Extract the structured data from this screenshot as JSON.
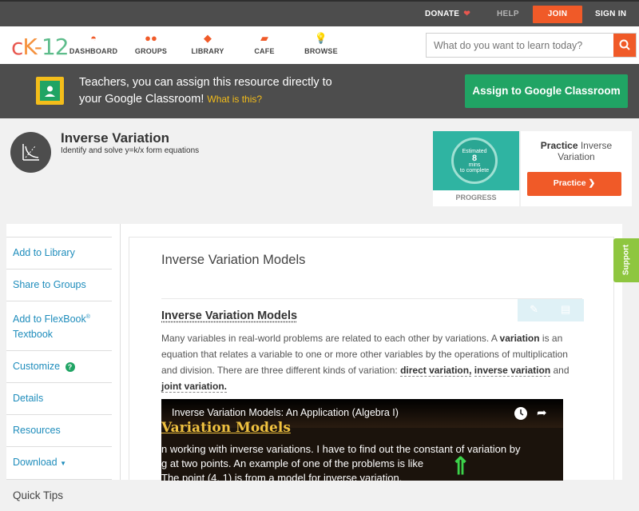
{
  "topbar": {
    "donate": "DONATE",
    "help": "HELP",
    "join": "JOIN",
    "signin": "SIGN IN"
  },
  "logo": {
    "text_c": "c",
    "text_k": "K-",
    "text_12": "12"
  },
  "nav": [
    {
      "label": "DASHBOARD",
      "icon": "dashboard-icon"
    },
    {
      "label": "GROUPS",
      "icon": "groups-icon"
    },
    {
      "label": "LIBRARY",
      "icon": "library-icon"
    },
    {
      "label": "CAFE",
      "icon": "cafe-icon"
    },
    {
      "label": "BROWSE",
      "icon": "browse-icon"
    }
  ],
  "search": {
    "placeholder": "What do you want to learn today?"
  },
  "google_banner": {
    "line1": "Teachers, you can assign this resource directly to",
    "line2": "your Google Classroom!",
    "what": "What is this?",
    "assign": "Assign to Google Classroom"
  },
  "concept": {
    "title": "Inverse Variation",
    "subtitle": "Identify and solve y=k/x form equations"
  },
  "progress": {
    "estimated": "Estimated",
    "minutes": "8",
    "mins": "mins",
    "to_complete": "to complete",
    "label": "PROGRESS"
  },
  "practice": {
    "bold": "Practice",
    "rest_1": "Inverse",
    "rest_2": "Variation",
    "button": "Practice"
  },
  "sidebar": {
    "add_library": "Add to Library",
    "share_groups": "Share to Groups",
    "add_flexbook_1": "Add to FlexBook",
    "reg": "®",
    "add_flexbook_2": "Textbook",
    "customize": "Customize",
    "details": "Details",
    "resources": "Resources",
    "download": "Download",
    "quick_tips": "Quick Tips"
  },
  "content": {
    "title": "Inverse Variation Models",
    "heading": "Inverse Variation Models",
    "p1": "Many variables in real-world problems are related to each other by variations. A ",
    "variation": "variation",
    "p2": " is an equation that relates a variable to one or more other variables by the operations of multiplication and division. There are three different kinds of variation: ",
    "direct": "direct variation,",
    "inverse": "inverse variation",
    "and": " and ",
    "joint": "joint variation."
  },
  "video": {
    "title": "Inverse Variation Models: An Application (Algebra I)",
    "heading": "Variation Models",
    "line1": "n working with inverse variations. I have to find out the constant of variation by",
    "line2": "g at two points. An example of one of the problems is like",
    "line3": "The point (4, 1) is from a model for inverse variation."
  },
  "support": "Support",
  "colors": {
    "accent": "#f05a28",
    "google_green": "#20a464",
    "teal": "#2fb4a2",
    "link": "#1f8dbc"
  }
}
